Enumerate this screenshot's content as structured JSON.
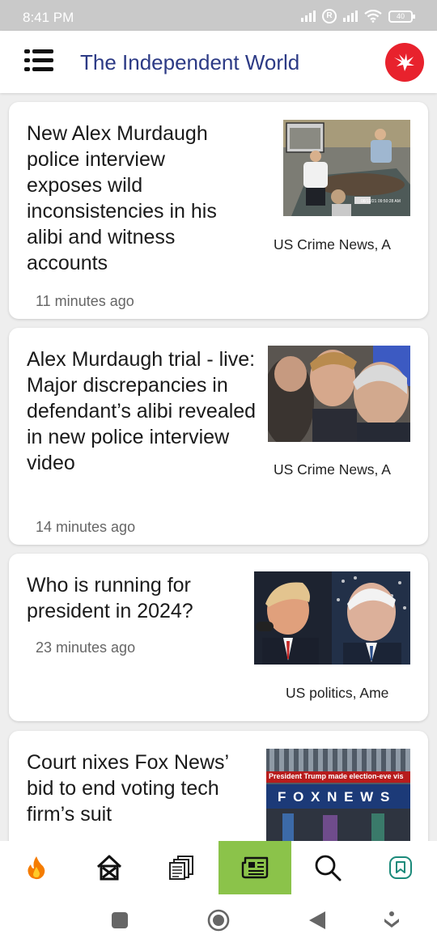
{
  "status_bar": {
    "time": "8:41 PM",
    "battery": "40"
  },
  "header": {
    "title": "The Independent World"
  },
  "articles": [
    {
      "headline": "New Alex Murdaugh police interview exposes wild inconsistencies in his alibi and witness accounts",
      "time_ago": "11 minutes ago",
      "source": "US Crime News, A",
      "thumb_stamp": "08/12/21 09:50:28 AM"
    },
    {
      "headline": "Alex Murdaugh trial - live: Major discrepancies in defendant’s alibi revealed in new police interview video",
      "time_ago": "14 minutes ago",
      "source": "US Crime News, A"
    },
    {
      "headline": "Who is running for president in 2024?",
      "time_ago": "23 minutes ago",
      "source": "US politics, Ame"
    },
    {
      "headline": "Court nixes Fox News’ bid to end voting tech firm’s suit",
      "ticker": "President Trump made election-eve vis",
      "sign": "F O X N E W S"
    }
  ],
  "bottom_nav": [
    {
      "icon": "fire-icon"
    },
    {
      "icon": "home-icon"
    },
    {
      "icon": "newspapers-icon"
    },
    {
      "icon": "newspaper-icon",
      "active": true
    },
    {
      "icon": "search-icon"
    },
    {
      "icon": "bookmark-icon"
    }
  ],
  "colors": {
    "title": "#2c3a85",
    "active_tab": "#8bc34a",
    "logo": "#e8222d"
  }
}
